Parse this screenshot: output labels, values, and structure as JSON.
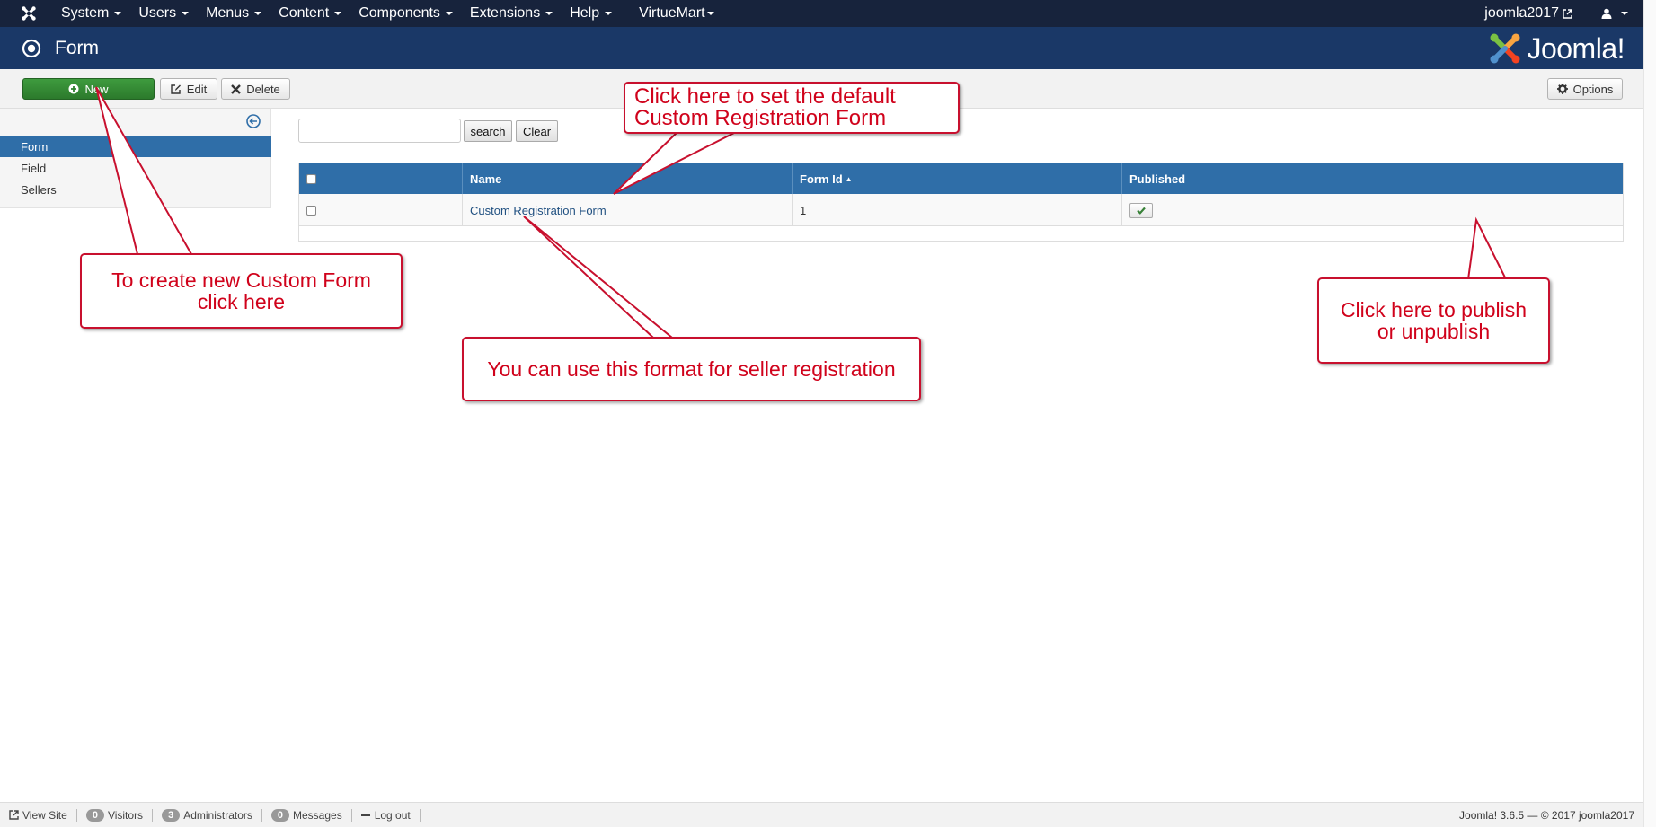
{
  "navbar": {
    "menus": [
      "System",
      "Users",
      "Menus",
      "Content",
      "Components",
      "Extensions",
      "Help"
    ],
    "extra_menu": "VirtueMart",
    "site_link": "joomla2017"
  },
  "header": {
    "title": "Form",
    "brand": "Joomla!"
  },
  "toolbar": {
    "new_label": "New",
    "edit_label": "Edit",
    "delete_label": "Delete",
    "options_label": "Options"
  },
  "sidebar": {
    "items": [
      {
        "label": "Form",
        "active": true
      },
      {
        "label": "Field",
        "active": false
      },
      {
        "label": "Sellers",
        "active": false
      }
    ]
  },
  "search": {
    "value": "",
    "search_label": "search",
    "clear_label": "Clear"
  },
  "table": {
    "columns": [
      "Name",
      "Form Id",
      "Published"
    ],
    "sort_indicator": "▲",
    "rows": [
      {
        "name": "Custom Registration Form",
        "form_id": "1",
        "published": true
      }
    ]
  },
  "callouts": {
    "default_form": "Click here to set the default Custom Registration Form",
    "default_form_line1": "Click here to set the default",
    "default_form_line2": "Custom Registration Form",
    "create_new_line1": "To create new Custom Form",
    "create_new_line2": "click here",
    "seller_format": "You can use this format for seller registration",
    "publish_line1": "Click here to publish",
    "publish_line2": "or unpublish"
  },
  "footer": {
    "view_site": "View Site",
    "visitors_count": "0",
    "visitors_label": "Visitors",
    "admins_count": "3",
    "admins_label": "Administrators",
    "messages_count": "0",
    "messages_label": "Messages",
    "logout": "Log out",
    "copyright": "Joomla! 3.6.5  —  © 2017 joomla2017"
  },
  "colors": {
    "navbar": "#17233c",
    "header": "#1a3867",
    "table_header": "#2f6ea8",
    "new_button": "#2f822f",
    "callout_text": "#d0021b"
  },
  "icons": [
    "joomla-icon",
    "caret-icon",
    "external-link-icon",
    "user-icon",
    "target-icon",
    "plus-circle-icon",
    "edit-icon",
    "close-icon",
    "gear-icon",
    "collapse-icon",
    "check-icon",
    "minus-icon"
  ]
}
